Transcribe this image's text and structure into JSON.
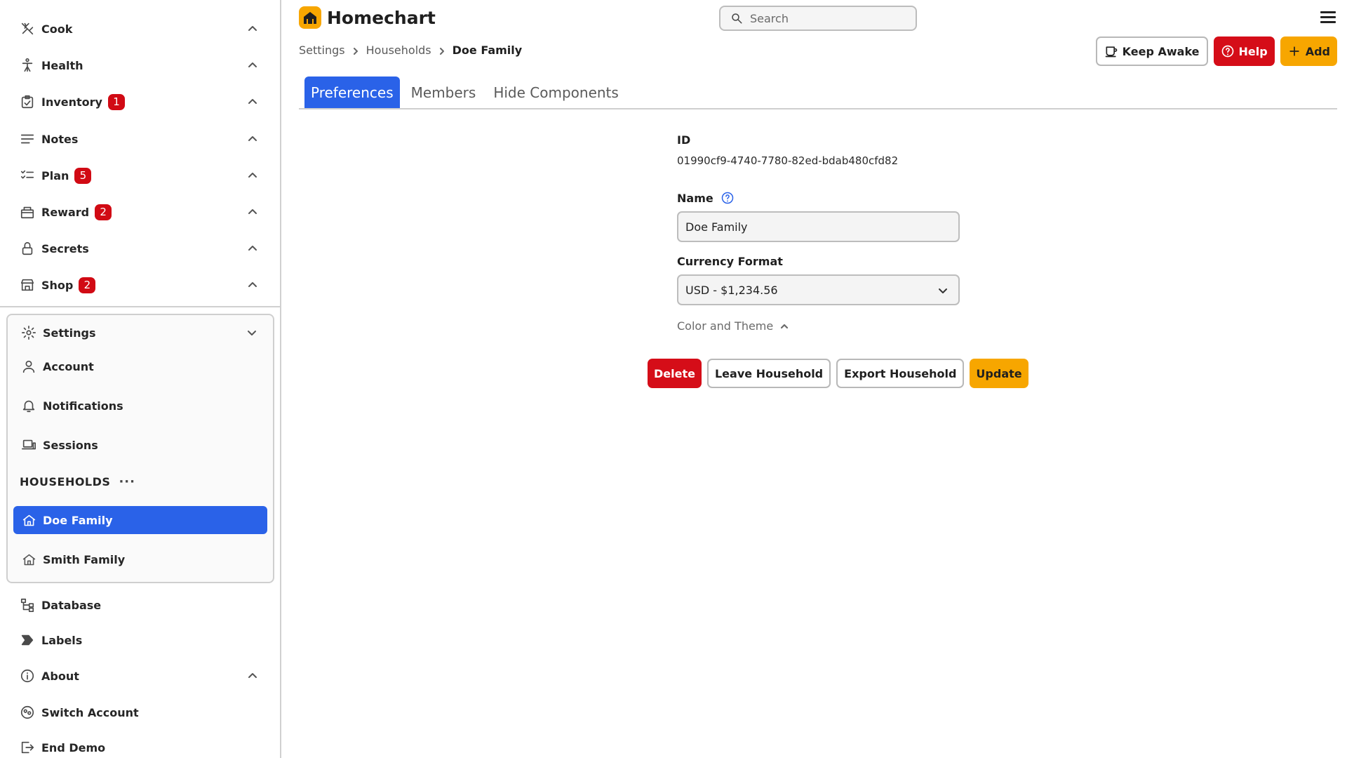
{
  "app": {
    "title": "Homechart"
  },
  "search": {
    "placeholder": "Search"
  },
  "sidebar": {
    "items": [
      {
        "label": "Cook",
        "badge": null,
        "icon": "cook-icon"
      },
      {
        "label": "Health",
        "badge": null,
        "icon": "health-icon"
      },
      {
        "label": "Inventory",
        "badge": "1",
        "icon": "inventory-icon"
      },
      {
        "label": "Notes",
        "badge": null,
        "icon": "notes-icon"
      },
      {
        "label": "Plan",
        "badge": "5",
        "icon": "plan-icon"
      },
      {
        "label": "Reward",
        "badge": "2",
        "icon": "reward-icon"
      },
      {
        "label": "Secrets",
        "badge": null,
        "icon": "lock-icon"
      },
      {
        "label": "Shop",
        "badge": "2",
        "icon": "shop-icon"
      }
    ],
    "settings": {
      "label": "Settings",
      "items": [
        {
          "label": "Account",
          "icon": "user-icon"
        },
        {
          "label": "Notifications",
          "icon": "bell-icon"
        },
        {
          "label": "Sessions",
          "icon": "devices-icon"
        }
      ],
      "households_heading": "HOUSEHOLDS",
      "households_more": "···",
      "households": [
        {
          "label": "Doe Family",
          "active": true
        },
        {
          "label": "Smith Family",
          "active": false
        }
      ]
    },
    "bottom_items": [
      {
        "label": "Database",
        "icon": "database-icon"
      },
      {
        "label": "Labels",
        "icon": "label-icon"
      },
      {
        "label": "About",
        "icon": "info-icon"
      },
      {
        "label": "Switch Account",
        "icon": "switch-account-icon"
      },
      {
        "label": "End Demo",
        "icon": "exit-icon"
      }
    ]
  },
  "breadcrumb": [
    "Settings",
    "Households",
    "Doe Family"
  ],
  "top_actions": {
    "keep_awake": "Keep Awake",
    "help": "Help",
    "add": "Add"
  },
  "tabs": [
    {
      "label": "Preferences",
      "active": true
    },
    {
      "label": "Members",
      "active": false
    },
    {
      "label": "Hide Components",
      "active": false
    }
  ],
  "form": {
    "id_label": "ID",
    "id_value": "01990cf9-4740-7780-82ed-bdab480cfd82",
    "name_label": "Name",
    "name_value": "Doe Family",
    "currency_label": "Currency Format",
    "currency_value": "USD - $1,234.56",
    "color_theme_label": "Color and Theme"
  },
  "form_actions": {
    "delete": "Delete",
    "leave": "Leave Household",
    "export": "Export Household",
    "update": "Update"
  },
  "colors": {
    "accent_blue": "#2a62e8",
    "brand_yellow": "#f7a600",
    "danger_red": "#d50d18",
    "badge_red": "#d10a14"
  }
}
